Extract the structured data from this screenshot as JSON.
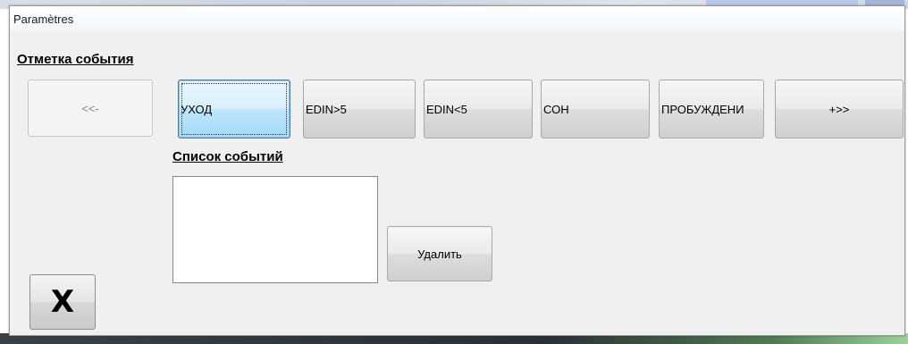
{
  "window": {
    "title": "Paramètres"
  },
  "event_mark": {
    "label": "Отметка события",
    "prev_button": "<<-",
    "event_buttons": [
      "УХОД",
      "EDIN>5",
      "EDIN<5",
      "СОН",
      "ПРОБУЖДЕНИ"
    ],
    "next_button": "+>>"
  },
  "event_list": {
    "label": "Список событий",
    "items": [],
    "delete_button": "Удалить"
  },
  "close_button": {
    "label": "X"
  },
  "colors": {
    "dialog_bg": "#f0f0f0",
    "focus_border": "#3c7fb1"
  }
}
